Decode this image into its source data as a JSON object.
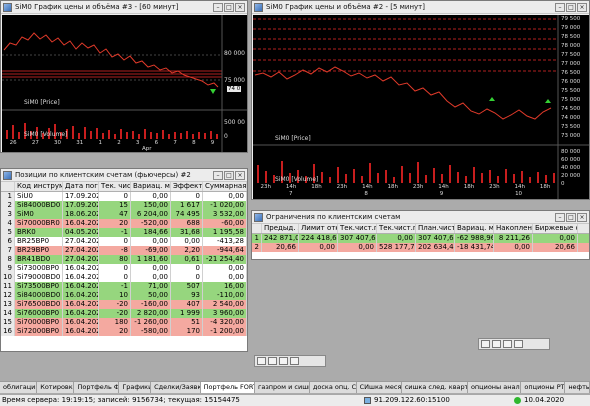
{
  "chart1": {
    "title": "SiM0 График цены и объёма #3 - [60 минут]",
    "price_labels": [
      "80 000",
      "75 000"
    ],
    "price_tag": "74 0",
    "price_caption": "SiM0 [Price]",
    "vol_labels": [
      "500 00",
      "0"
    ],
    "vol_caption": "SiM0 [Volume]",
    "x_labels": [
      "26",
      "27",
      "30",
      "31",
      "1",
      "2",
      "3",
      "6",
      "7",
      "8",
      "9"
    ],
    "x_month": "Apr"
  },
  "chart2": {
    "title": "SiM0 График цены и объёма #2 - [5 минут]",
    "price_labels": [
      "79 500",
      "79 000",
      "78 500",
      "78 000",
      "77 500",
      "77 000",
      "76 500",
      "76 000",
      "75 500",
      "75 000",
      "74 500",
      "74 000",
      "73 500",
      "73 000"
    ],
    "price_caption": "SiM0 [Price]",
    "vol_labels": [
      "80 000",
      "60 000",
      "40 000",
      "20 000",
      "0"
    ],
    "vol_caption": "SiM0 [Volume]",
    "x_labels": [
      "23h",
      "14h",
      "18h",
      "23h",
      "14h",
      "18h",
      "23h",
      "14h",
      "18h",
      "23h",
      "14h",
      "18h"
    ],
    "x_days": [
      "7",
      "8",
      "9",
      "10"
    ]
  },
  "positions": {
    "title": "Позиции по клиентским счетам (фьючерсы) #2",
    "headers": [
      "Код инструмента",
      "Дата погаш.",
      "Тек. чист.поз.",
      "Вариац. маржа",
      "Эффект. цена",
      "Суммарная в..."
    ],
    "rows": [
      {
        "code": "SiU0",
        "date": "17.09.2020",
        "pos": "0",
        "vm": "0,00",
        "price": "0",
        "sum": "0,00",
        "color": "white"
      },
      {
        "code": "Si84000BD0",
        "date": "17.09.2020",
        "pos": "15",
        "vm": "150,00",
        "price": "1 617",
        "sum": "-1 020,00",
        "color": "green"
      },
      {
        "code": "SiM0",
        "date": "18.06.2020",
        "pos": "47",
        "vm": "6 204,00",
        "price": "74 495",
        "sum": "3 532,00",
        "color": "green"
      },
      {
        "code": "Si70000BR0",
        "date": "16.04.2020",
        "pos": "20",
        "vm": "-520,00",
        "price": "688",
        "sum": "-60,00",
        "color": "red"
      },
      {
        "code": "BRK0",
        "date": "04.05.2020",
        "pos": "-1",
        "vm": "184,66",
        "price": "31,68",
        "sum": "1 195,58",
        "color": "green"
      },
      {
        "code": "BR25BP0",
        "date": "27.04.2020",
        "pos": "0",
        "vm": "0,00",
        "price": "0,00",
        "sum": "-413,28",
        "color": "white"
      },
      {
        "code": "BR29BP0",
        "date": "27.04.2020",
        "pos": "-8",
        "vm": "-69,00",
        "price": "2,20",
        "sum": "-944,64",
        "color": "red"
      },
      {
        "code": "BR41BD0",
        "date": "27.04.2020",
        "pos": "80",
        "vm": "1 181,60",
        "price": "0,61",
        "sum": "-21 254,40",
        "color": "green"
      },
      {
        "code": "Si73000BP0",
        "date": "16.04.2020",
        "pos": "0",
        "vm": "0,00",
        "price": "0",
        "sum": "0,00",
        "color": "white"
      },
      {
        "code": "Si79000BD0",
        "date": "16.04.2020",
        "pos": "0",
        "vm": "0,00",
        "price": "0",
        "sum": "0,00",
        "color": "white"
      },
      {
        "code": "Si73500BP0",
        "date": "16.04.2020",
        "pos": "-1",
        "vm": "71,00",
        "price": "507",
        "sum": "16,00",
        "color": "green"
      },
      {
        "code": "Si84000BD0",
        "date": "16.04.2020",
        "pos": "10",
        "vm": "50,00",
        "price": "93",
        "sum": "-110,00",
        "color": "green"
      },
      {
        "code": "Si76500BD0",
        "date": "16.04.2020",
        "pos": "-20",
        "vm": "-160,00",
        "price": "407",
        "sum": "2 540,00",
        "color": "red"
      },
      {
        "code": "Si76000BP0",
        "date": "16.04.2020",
        "pos": "-20",
        "vm": "2 820,00",
        "price": "1 999",
        "sum": "3 960,00",
        "color": "green"
      },
      {
        "code": "Si70000BP0",
        "date": "16.04.2020",
        "pos": "180",
        "vm": "-1 260,00",
        "price": "51",
        "sum": "-4 320,00",
        "color": "red"
      },
      {
        "code": "Si72000BP0",
        "date": "16.04.2020",
        "pos": "20",
        "vm": "-580,00",
        "price": "170",
        "sum": "-1 200,00",
        "color": "red"
      }
    ]
  },
  "limits": {
    "title": "Ограничения по клиентским счетам",
    "headers": [
      "",
      "Предыд. лимит",
      "Лимит откр. поз.",
      "Тек.чист.поз.",
      "Тек.чист.поз. (...)",
      "План.чист.поз.",
      "Вариац. маржа",
      "Накоплен. доход",
      "Биржевые сборы"
    ],
    "rows": [
      {
        "values": [
          "1",
          "242 871,06",
          "224 418,66",
          "307 407,62",
          "0,00",
          "307 407,62",
          "-62 988,96",
          "8 211,26",
          "0,00"
        ],
        "color": "green"
      },
      {
        "values": [
          "2",
          "20,66",
          "0,00",
          "0,00",
          "528 177,71",
          "202 634,48",
          "-18 431,74",
          "0,00",
          "20,66"
        ],
        "color": "red"
      }
    ]
  },
  "tabs": [
    "облигации",
    "Котировки",
    "Портфель ФР",
    "Графики",
    "Сделки/Заявки",
    "Портфель FORTS",
    "газпром и сишка",
    "доска опц. СИ",
    "СИшка месяц",
    "сишка след. квартал",
    "опционы анализ",
    "опционы РТС",
    "нефть"
  ],
  "active_tab": 5,
  "status": {
    "server_time": "Время сервера: 19:19:15; записей: 9156734; текущая: 15154475",
    "ip": "91.209.122.60:15100",
    "date": "10.04.2020"
  },
  "colors": {
    "green_row": "#96d67e",
    "red_row": "#f4a9a0",
    "price_line": "#cc2020",
    "volume_bar": "#c81e1e"
  }
}
